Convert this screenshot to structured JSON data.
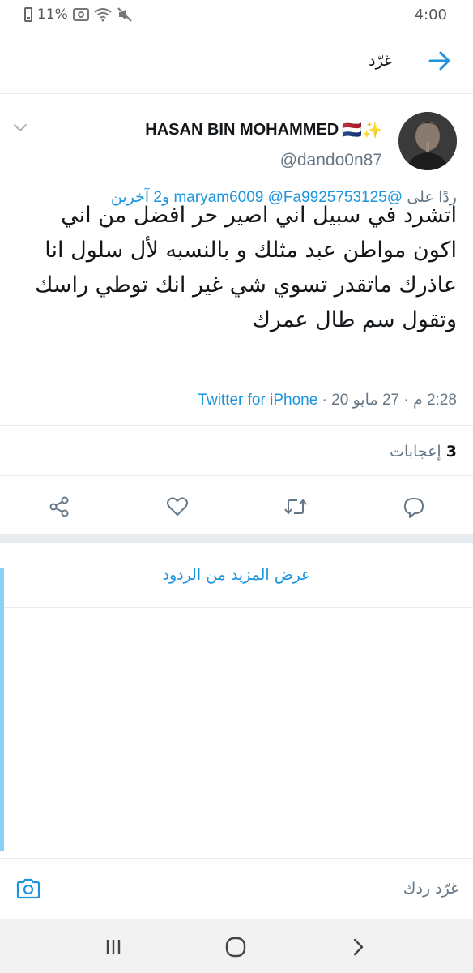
{
  "status_bar": {
    "battery": "11%",
    "time": "4:00"
  },
  "header": {
    "title": "غرّد"
  },
  "tweet": {
    "display_name": "HASAN BIN MOHAMMED",
    "name_emoji": "🇳🇱✨",
    "handle": "@dando0n87",
    "reply_prefix": "ردًا على",
    "reply_mentions": "@maryam6009 @Fa9925753125",
    "reply_others": "و2 آخرين",
    "text": "اتشرد في سبيل اني اصير حر افضل من اني اكون مواطن عبد مثلك و بالنسبه لأل سلول انا عاذرك ماتقدر تسوي شي غير انك توطي راسك وتقول سم طال عمرك",
    "time": "2:28 م",
    "date": "27 مايو 20",
    "source": "Twitter for iPhone",
    "likes_count": "3",
    "likes_label": "إعجابات"
  },
  "more_replies": {
    "label": "عرض المزيد من الردود"
  },
  "compose": {
    "placeholder": "غرّد ردك"
  },
  "colors": {
    "accent": "#1b95e0",
    "muted": "#657786",
    "border": "#e6ecf0",
    "thread": "#8ccff5"
  }
}
